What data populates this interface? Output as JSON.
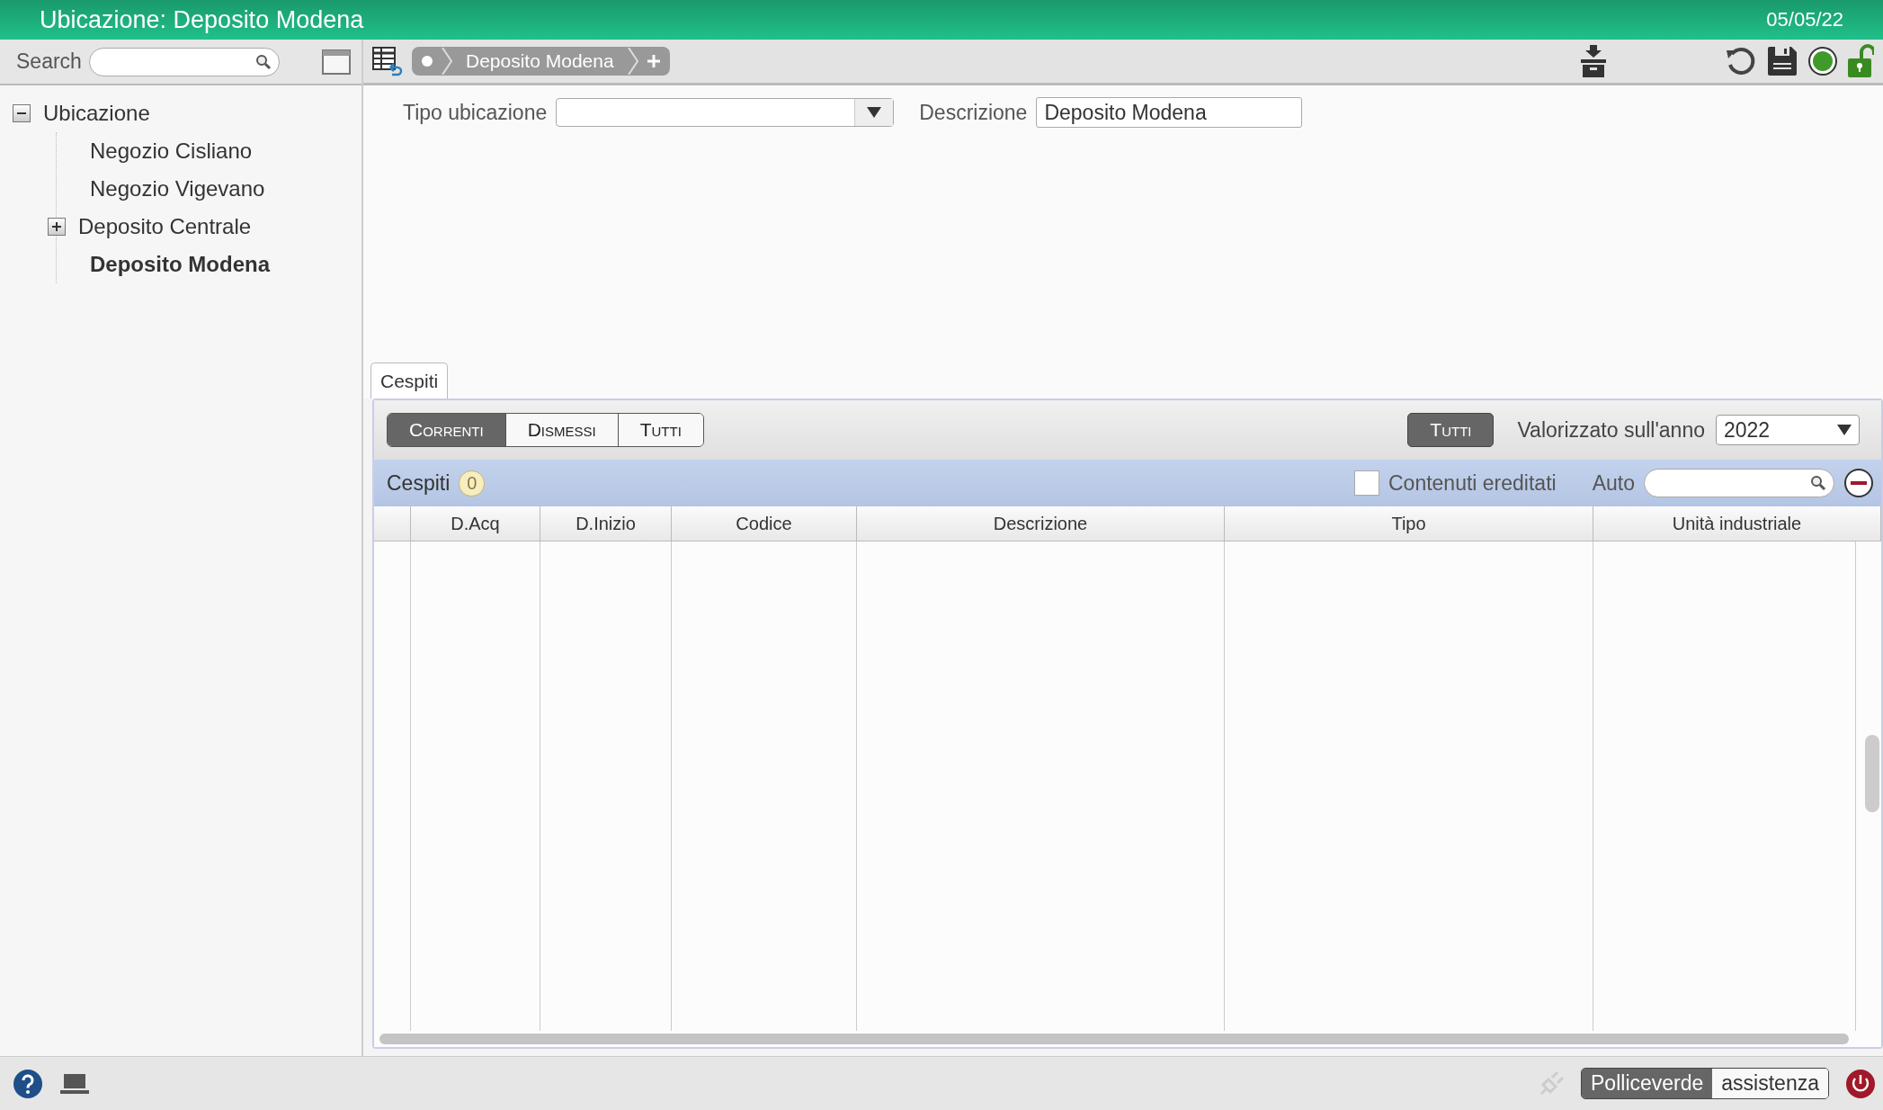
{
  "window": {
    "title": "Ubicazione: Deposito Modena",
    "date": "05/05/22"
  },
  "sidebar": {
    "search": {
      "label": "Search"
    },
    "tree": [
      {
        "label": "Ubicazione",
        "expanded": true,
        "selected": false,
        "children": [
          {
            "label": "Negozio Cisliano",
            "selected": false
          },
          {
            "label": "Negozio Vigevano",
            "selected": false
          },
          {
            "label": "Deposito Centrale",
            "expanded": false,
            "selected": false
          },
          {
            "label": "Deposito Modena",
            "selected": true
          }
        ]
      }
    ]
  },
  "breadcrumb": {
    "items": [
      "Deposito Modena"
    ]
  },
  "form": {
    "fields": [
      {
        "kind": "select",
        "label": "Tipo ubicazione"
      },
      {
        "kind": "text",
        "label": "Descrizione",
        "value": "Deposito Modena"
      }
    ]
  },
  "tabs": [
    {
      "label": "Cespiti",
      "selected": true
    }
  ],
  "filters": [
    {
      "label": "Correnti",
      "selected": true
    },
    {
      "label": "Dismessi",
      "selected": false
    },
    {
      "label": "Tutti",
      "selected": false
    }
  ],
  "all_toggle": {
    "label": "Tutti",
    "on": true
  },
  "year": {
    "label": "Valorizzato sull'anno",
    "value": "2022"
  },
  "list": {
    "title": "Cespiti",
    "count": "0",
    "inherited": {
      "label": "Contenuti ereditati",
      "checked": false
    },
    "auto_label": "Auto"
  },
  "table": {
    "columns": [
      "D.Acq",
      "D.Inizio",
      "Codice",
      "Descrizione",
      "Tipo",
      "Unità industriale"
    ]
  },
  "status_bar": {
    "company": "Polliceverde",
    "user": "assistenza"
  }
}
